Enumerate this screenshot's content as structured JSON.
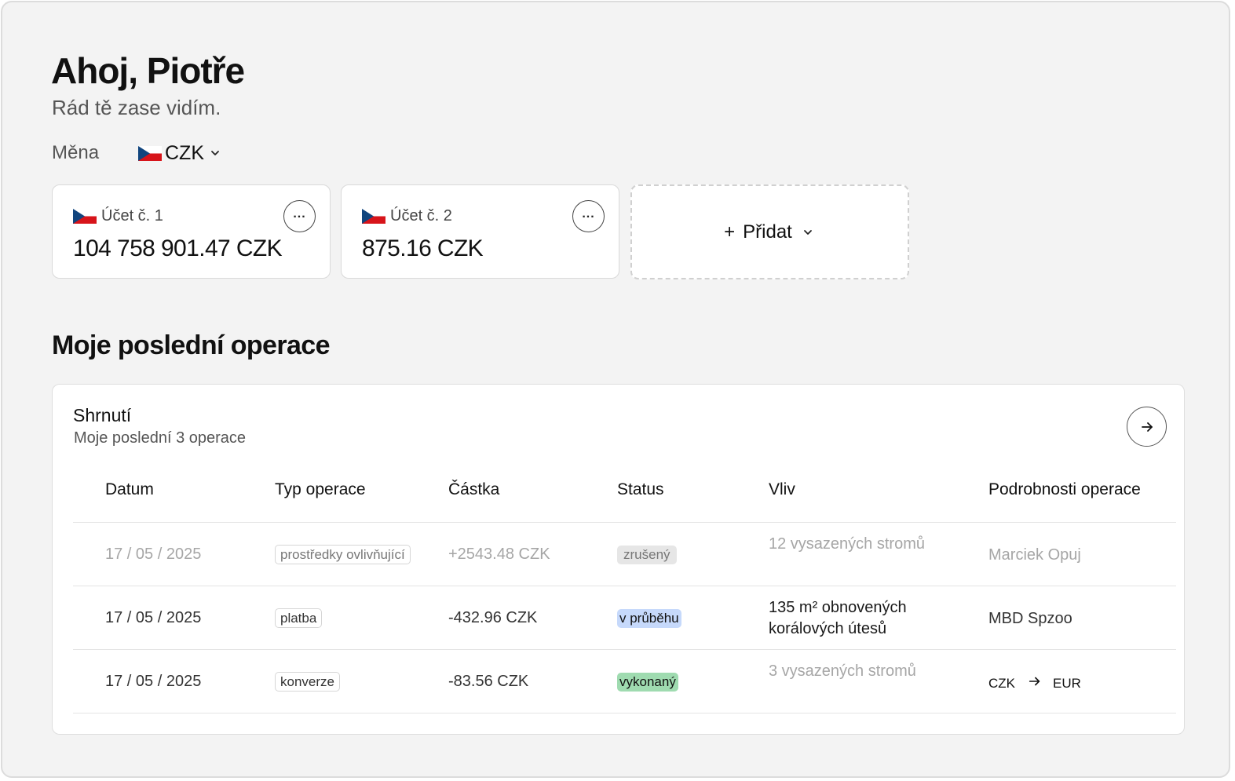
{
  "greeting": {
    "title": "Ahoj, Piotře",
    "subtitle": "Rád tě zase vidím."
  },
  "currency": {
    "label": "Měna",
    "selected": "CZK",
    "flag_icon": "czech-flag-icon"
  },
  "accounts": [
    {
      "name": "Účet č. 1",
      "balance": "104 758 901.47 CZK"
    },
    {
      "name": "Účet č. 2",
      "balance": "875.16 CZK"
    }
  ],
  "add_account": {
    "plus": "+",
    "label": "Přidat"
  },
  "recent": {
    "section_title": "Moje poslední operace",
    "card_title": "Shrnutí",
    "card_subtitle": "Moje poslední 3 operace",
    "columns": [
      "Datum",
      "Typ operace",
      "Částka",
      "Status",
      "Vliv",
      "Podrobnosti operace"
    ],
    "rows": [
      {
        "date": "17 / 05 / 2025",
        "type": "prostředky ovlivňující",
        "amount": "+2543.48 CZK",
        "status": "zrušený",
        "impact": "12 vysazených stromů",
        "details": "Marciek Opuj"
      },
      {
        "date": "17 / 05 / 2025",
        "type": "platba",
        "amount": "-432.96 CZK",
        "status": "v průběhu",
        "impact": "135 m² obnovených korálových útesů",
        "details": "MBD Spzoo"
      },
      {
        "date": "17 / 05 / 2025",
        "type": "konverze",
        "amount": "-83.56 CZK",
        "status": "vykonaný",
        "impact": "3 vysazených stromů",
        "details_from": "CZK",
        "details_to": "EUR"
      }
    ]
  },
  "colors": {
    "background": "#f3f3f3",
    "card": "#ffffff",
    "status_cancelled": "#e6e6e6",
    "status_in_progress": "#c6d9fb",
    "status_done": "#9fdbb0"
  }
}
